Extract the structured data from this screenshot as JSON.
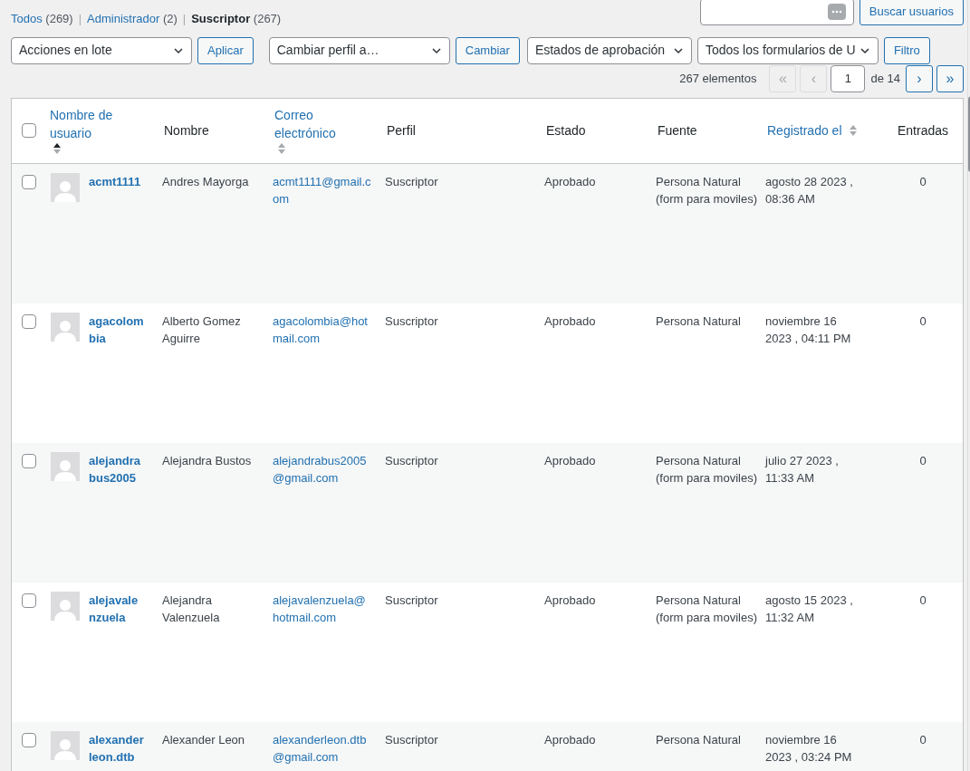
{
  "views": [
    {
      "label": "Todos",
      "count": "(269)",
      "selected": false
    },
    {
      "separator": "|",
      "label": "Administrador",
      "count": "(2)",
      "selected": false
    },
    {
      "separator": "|",
      "label": "Suscriptor",
      "count": "(267)",
      "selected": true
    }
  ],
  "search": {
    "button": "Buscar usuarios"
  },
  "bulk": {
    "select": "Acciones en lote",
    "button": "Aplicar"
  },
  "role": {
    "select": "Cambiar perfil a…",
    "button": "Cambiar"
  },
  "filters": {
    "selects": [
      "Estados de aprobación",
      "Todos los formularios de U"
    ],
    "button": "Filtro"
  },
  "pagination": {
    "count": "267 elementos",
    "first": "«",
    "prev": "‹",
    "page": "1",
    "of": "de 14",
    "next": "›",
    "last": "»"
  },
  "select_all": {
    "checked": false
  },
  "columns": [
    {
      "label": "Nombre de usuario",
      "sortable": true,
      "sorted": true
    },
    {
      "label": "Nombre",
      "sortable": false
    },
    {
      "label": "Correo electrónico",
      "sortable": true,
      "sorted": false
    },
    {
      "label": "Perfil",
      "sortable": false
    },
    {
      "label": "Estado",
      "sortable": false
    },
    {
      "label": "Fuente",
      "sortable": false
    },
    {
      "label": "Registrado el",
      "sortable": true,
      "sorted": false
    },
    {
      "label": "Entradas",
      "sortable": false
    }
  ],
  "rows": [
    {
      "checked": false,
      "username": "acmt1111",
      "name": "Andres Mayorga",
      "email": "acmt1111@gmail.com",
      "role": "Suscriptor",
      "status": "Aprobado",
      "source": "Persona Natural (form para moviles)",
      "registered": "agosto 28 2023 , 08:36 AM",
      "posts": "0"
    },
    {
      "checked": false,
      "username": "agacolombia",
      "name": "Alberto Gomez Aguirre",
      "email": "agacolombia@hotmail.com",
      "role": "Suscriptor",
      "status": "Aprobado",
      "source": "Persona Natural",
      "registered": "noviembre 16 2023 , 04:11 PM",
      "posts": "0"
    },
    {
      "checked": false,
      "username": "alejandrabus2005",
      "name": "Alejandra Bustos",
      "email": "alejandrabus2005@gmail.com",
      "role": "Suscriptor",
      "status": "Aprobado",
      "source": "Persona Natural (form para moviles)",
      "registered": "julio 27 2023 , 11:33 AM",
      "posts": "0"
    },
    {
      "checked": false,
      "username": "alejavalenzuela",
      "name": "Alejandra Valenzuela",
      "email": "alejavalenzuela@hotmail.com",
      "role": "Suscriptor",
      "status": "Aprobado",
      "source": "Persona Natural (form para moviles)",
      "registered": "agosto 15 2023 , 11:32 AM",
      "posts": "0"
    },
    {
      "checked": false,
      "username": "alexanderleon.dtb",
      "name": "Alexander Leon",
      "email": "alexanderleon.dtb@gmail.com",
      "role": "Suscriptor",
      "status": "Aprobado",
      "source": "Persona Natural",
      "registered": "noviembre 16 2023 , 03:24 PM",
      "posts": "0"
    }
  ]
}
